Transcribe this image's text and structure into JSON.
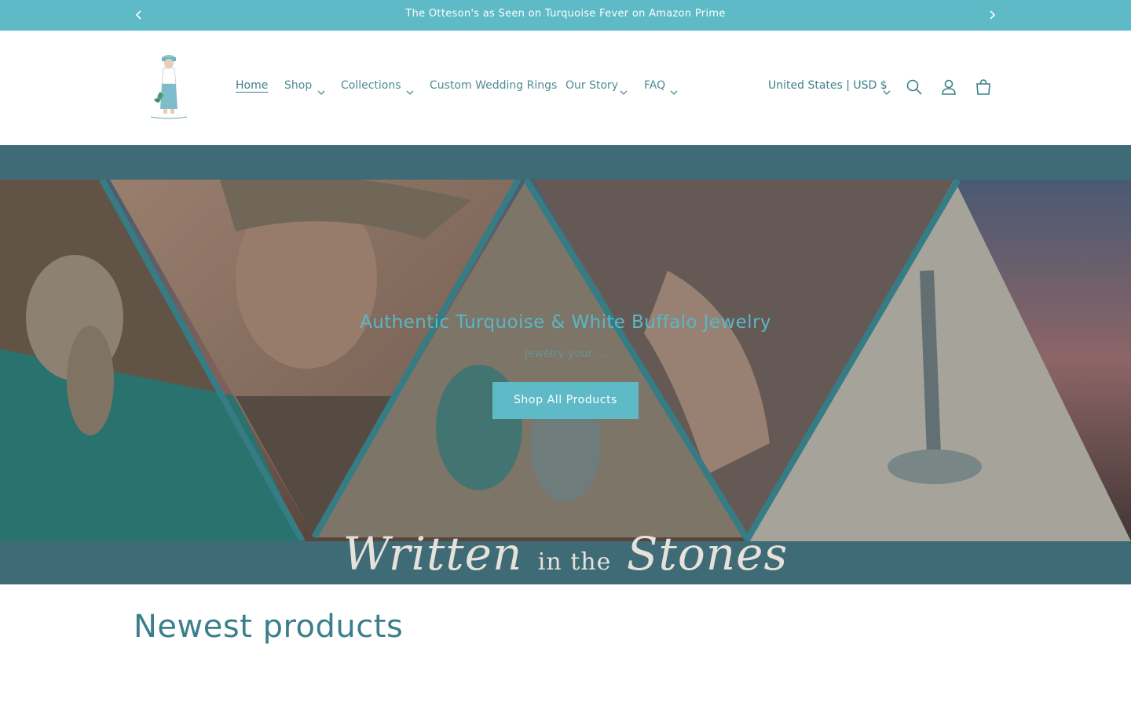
{
  "announcement": {
    "text": "The Otteson's as Seen on Turquoise Fever on Amazon Prime",
    "prev_icon": "chevron-left-icon",
    "next_icon": "chevron-right-icon"
  },
  "header": {
    "logo_icon": "woman-illustration-logo",
    "nav": [
      {
        "label": "Home",
        "active": true,
        "has_dropdown": false
      },
      {
        "label": "Shop",
        "has_dropdown": true
      },
      {
        "label": "Collections",
        "has_dropdown": true
      },
      {
        "label": "Custom Wedding Rings",
        "has_dropdown": false
      },
      {
        "label": "Our Story",
        "has_dropdown": true
      },
      {
        "label": "FAQ",
        "has_dropdown": true
      }
    ],
    "locale": "United States | USD $",
    "icons": [
      "search-icon",
      "account-icon",
      "cart-icon"
    ]
  },
  "hero": {
    "heading": "Authentic Turquoise & White Buffalo Jewelry",
    "subheading": "Jewelry your ...",
    "button_label": "Shop All Products",
    "brand_word_1": "Written",
    "brand_word_2": "in the",
    "brand_word_3": "Stones"
  },
  "newest": {
    "title": "Newest products"
  },
  "colors": {
    "accent": "#5ebac6",
    "heading_teal": "#3b7f8c",
    "hero_backdrop": "#3e6b76"
  }
}
